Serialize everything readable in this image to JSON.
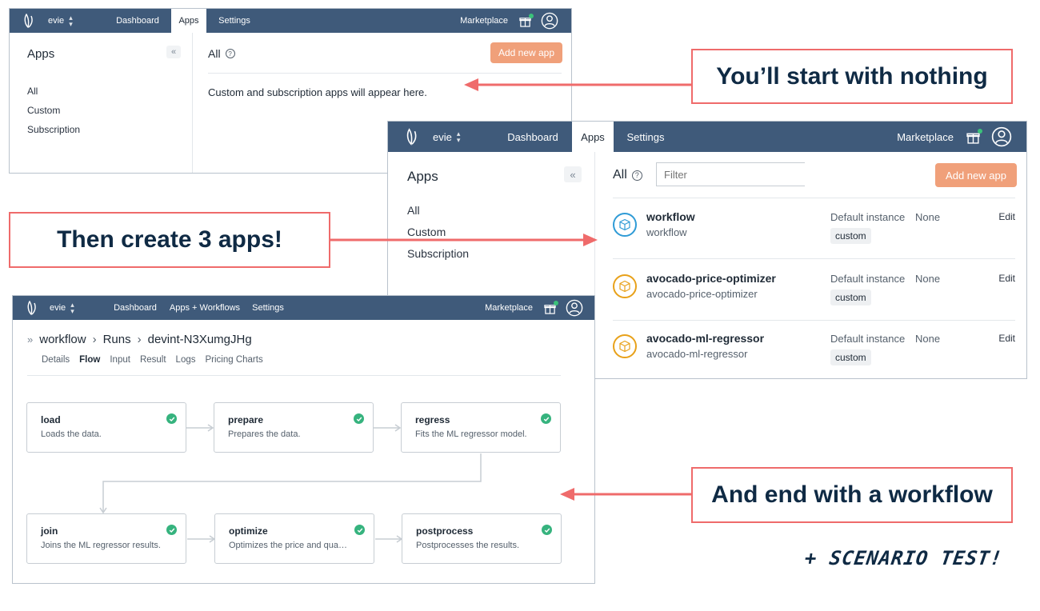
{
  "nav": {
    "org": "evie",
    "dashboard": "Dashboard",
    "apps": "Apps",
    "apps_workflows": "Apps + Workflows",
    "settings": "Settings",
    "marketplace": "Marketplace"
  },
  "apps_empty": {
    "sidebar_title": "Apps",
    "sidebar_items": [
      "All",
      "Custom",
      "Subscription"
    ],
    "heading": "All",
    "add_button": "Add new app",
    "empty_message": "Custom and subscription apps will appear here."
  },
  "apps_list": {
    "sidebar_title": "Apps",
    "sidebar_items": [
      "All",
      "Custom",
      "Subscription"
    ],
    "heading": "All",
    "filter_placeholder": "Filter",
    "add_button": "Add new app",
    "apps": [
      {
        "name": "workflow",
        "subtitle": "workflow",
        "instance_label": "Default instance",
        "instance_value": "None",
        "badge": "custom",
        "edit": "Edit",
        "color": "#2f9bd6"
      },
      {
        "name": "avocado-price-optimizer",
        "subtitle": "avocado-price-optimizer",
        "instance_label": "Default instance",
        "instance_value": "None",
        "badge": "custom",
        "edit": "Edit",
        "color": "#e8a11a"
      },
      {
        "name": "avocado-ml-regressor",
        "subtitle": "avocado-ml-regressor",
        "instance_label": "Default instance",
        "instance_value": "None",
        "badge": "custom",
        "edit": "Edit",
        "color": "#e8a11a"
      }
    ]
  },
  "workflow": {
    "breadcrumb": [
      "workflow",
      "Runs",
      "devint-N3XumgJHg"
    ],
    "tabs": [
      "Details",
      "Flow",
      "Input",
      "Result",
      "Logs",
      "Pricing Charts"
    ],
    "active_tab": "Flow",
    "nodes": [
      {
        "title": "load",
        "desc": "Loads the data."
      },
      {
        "title": "prepare",
        "desc": "Prepares the data."
      },
      {
        "title": "regress",
        "desc": "Fits the ML regressor model."
      },
      {
        "title": "join",
        "desc": "Joins the ML regressor results."
      },
      {
        "title": "optimize",
        "desc": "Optimizes the price and quantity."
      },
      {
        "title": "postprocess",
        "desc": "Postprocesses the results."
      }
    ]
  },
  "callouts": {
    "start": "You’ll start with nothing",
    "create": "Then create 3 apps!",
    "end": "And end with a workflow",
    "note": "+ SCENARIO TEST!"
  },
  "colors": {
    "nav": "#3f5a7a",
    "accent_button": "#f0a07a",
    "callout_border": "#ef6b6b",
    "success": "#36b37e",
    "callout_text": "#0f2a44"
  }
}
